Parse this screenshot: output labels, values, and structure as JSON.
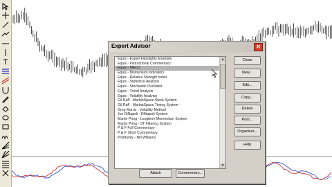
{
  "dialog": {
    "title": "Expert Advisor",
    "close_glyph": "✕",
    "list": [
      "Equis - Expert Highlights Example",
      "Equis - Instructional Commentary",
      "Equis - MACD",
      "Equis - Momentum Indicators",
      "Equis - Relative Strength Index",
      "Equis - Statistical Analysis",
      "Equis - Stochastic Oscillator",
      "Equis - Trend Analysis",
      "Equis - Volatility Analysis",
      "Gil Raff - MarketSpace Stock System",
      "Gil Raff - MarketSpace Timing System",
      "Greg Morris - Volatility Method",
      "Joe DiNapoli - DiNapoli System",
      "Martin Pring - Longterm Momentum System",
      "Martin Pring - ST Filtering System",
      "P & F Full Commentary",
      "P & F Short Commentary",
      "Profitunity - Bill Williams"
    ],
    "selected_index": 2,
    "buttons": {
      "close": "Close",
      "new": "New...",
      "edit": "Edit...",
      "copy": "Copy...",
      "delete": "Delete",
      "print": "Print...",
      "organizer": "Organizer...",
      "help": "Help",
      "attach": "Attach",
      "commentary": "Commentary..."
    }
  },
  "toolbar": {
    "tools": [
      "arrow-icon",
      "crosshair-icon",
      "line-icon",
      "trend-icon",
      "horizontal-line-icon",
      "vertical-line-icon",
      "text-icon",
      "fibonacci-icon",
      "channel-icon",
      "magnet-icon",
      "pencil-icon",
      "eraser-icon",
      "ellipse-icon",
      "rectangle-icon",
      "cycle-icon",
      "speed-line-icon",
      "gann-icon",
      "quadrant-icon",
      "erase-all-icon"
    ]
  },
  "colors": {
    "dialog_bg": "#d4d0c8",
    "selection": "#b4b4b4",
    "candles": "#000000",
    "osc_blue": "#1a3cc8",
    "osc_red": "#c81a1a"
  }
}
